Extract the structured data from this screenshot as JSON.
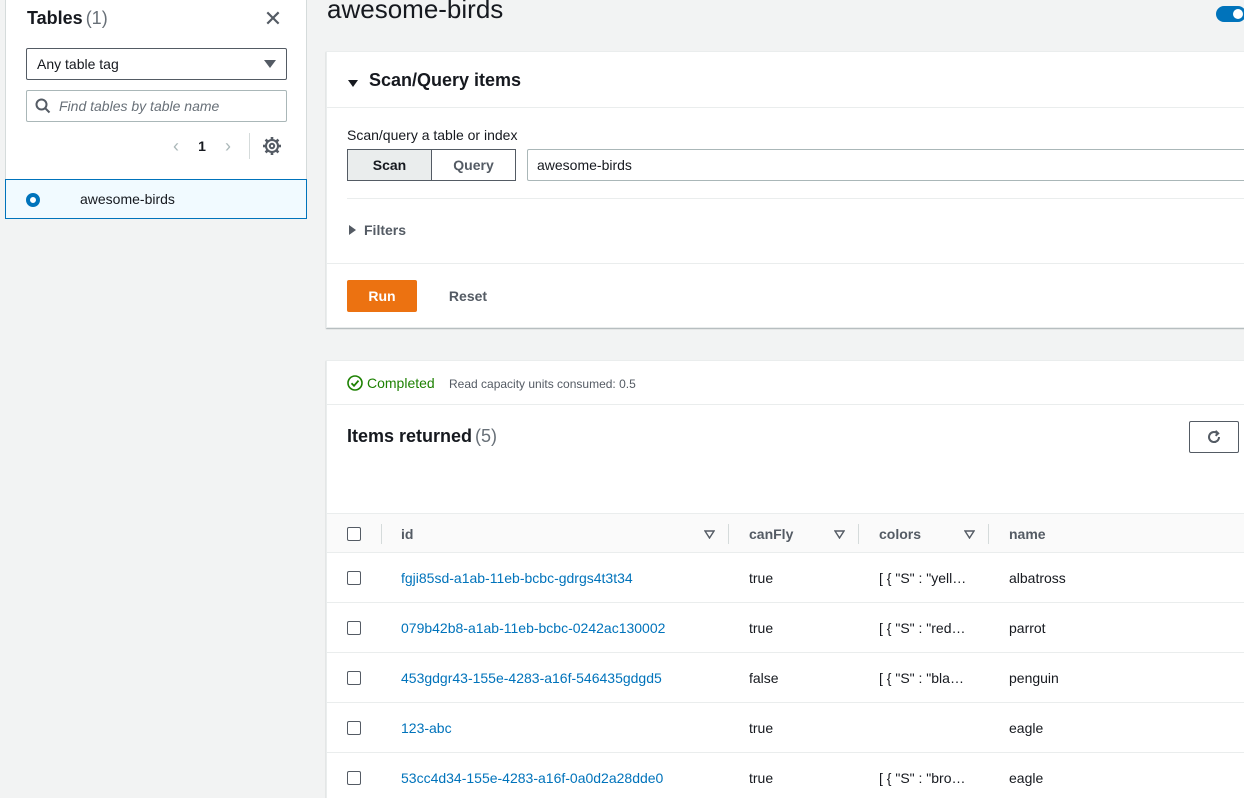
{
  "sidebar": {
    "title": "Tables",
    "count": "(1)",
    "tag_filter": "Any table tag",
    "search_placeholder": "Find tables by table name",
    "page": "1",
    "tables": [
      {
        "name": "awesome-birds",
        "selected": true
      }
    ]
  },
  "header": {
    "title": "awesome-birds"
  },
  "scan_panel": {
    "title": "Scan/Query items",
    "label": "Scan/query a table or index",
    "scan_label": "Scan",
    "query_label": "Query",
    "selected_table": "awesome-birds",
    "filters_label": "Filters",
    "run_label": "Run",
    "reset_label": "Reset"
  },
  "results": {
    "status": "Completed",
    "rcu": "Read capacity units consumed: 0.5",
    "title": "Items returned",
    "count": "(5)",
    "columns": [
      "id",
      "canFly",
      "colors",
      "name"
    ],
    "rows": [
      {
        "id": "fgji85sd-a1ab-11eb-bcbc-gdrgs4t3t34",
        "canFly": "true",
        "colors": "[ { \"S\" : \"yell…",
        "name": "albatross"
      },
      {
        "id": "079b42b8-a1ab-11eb-bcbc-0242ac130002",
        "canFly": "true",
        "colors": "[ { \"S\" : \"red…",
        "name": "parrot"
      },
      {
        "id": "453gdgr43-155e-4283-a16f-546435gdgd5",
        "canFly": "false",
        "colors": "[ { \"S\" : \"bla…",
        "name": "penguin"
      },
      {
        "id": "123-abc",
        "canFly": "true",
        "colors": "",
        "name": "eagle"
      },
      {
        "id": "53cc4d34-155e-4283-a16f-0a0d2a28dde0",
        "canFly": "true",
        "colors": "[ { \"S\" : \"bro…",
        "name": "eagle"
      }
    ]
  },
  "colors": {
    "accent": "#0073bb",
    "run_button": "#ec7211",
    "success": "#1d8102"
  }
}
